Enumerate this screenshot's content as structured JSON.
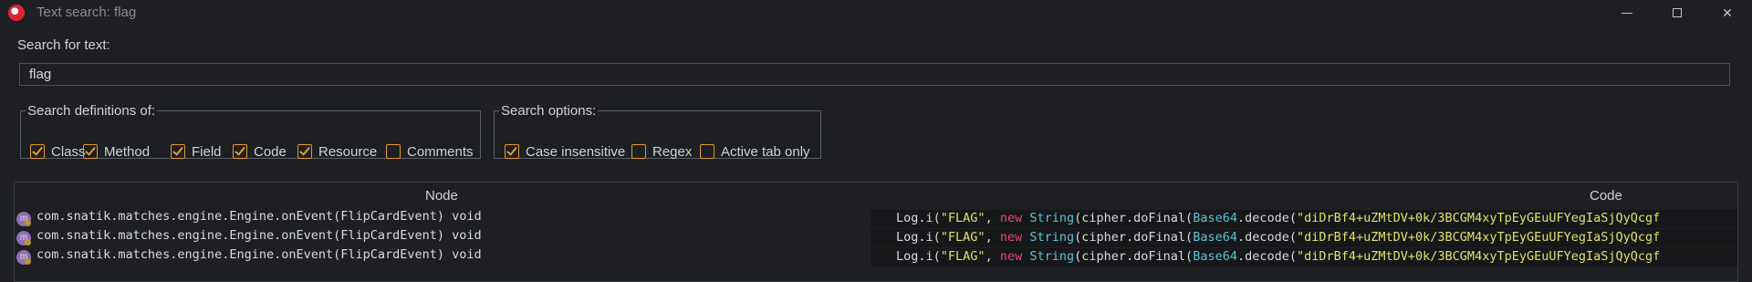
{
  "window": {
    "title": "Text search: flag",
    "icon": "jadx-app-icon",
    "controls": [
      "minimize-icon",
      "maximize-icon",
      "close-icon"
    ]
  },
  "search": {
    "label": "Search for text:",
    "value": "flag"
  },
  "definitions": {
    "legend": "Search definitions of:",
    "items": [
      {
        "label": "Class",
        "checked": true
      },
      {
        "label": "Method",
        "checked": true
      },
      {
        "label": "Field",
        "checked": true
      },
      {
        "label": "Code",
        "checked": true
      },
      {
        "label": "Resource",
        "checked": true
      },
      {
        "label": "Comments",
        "checked": false
      }
    ]
  },
  "options": {
    "legend": "Search options:",
    "items": [
      {
        "label": "Case insensitive",
        "checked": true
      },
      {
        "label": "Regex",
        "checked": false
      },
      {
        "label": "Active tab only",
        "checked": false
      }
    ]
  },
  "results": {
    "columns": {
      "node": "Node",
      "code": "Code"
    },
    "rows": [
      {
        "icon_letter": "m",
        "node": "com.snatik.matches.engine.Engine.onEvent(FlipCardEvent) void",
        "code": {
          "pre": "Log.i(",
          "s1": "\"FLAG\"",
          "c1": ", ",
          "kw": "new",
          "sp": " ",
          "cls1": "String",
          "mid": "(cipher.doFinal(",
          "cls2": "Base64",
          "dec": ".decode(",
          "s2": "\"diDrBf4+uZMtDV+0k/3BCGM4xyTpEyGEuUFYegIaSjQyQcgf"
        }
      },
      {
        "icon_letter": "m",
        "node": "com.snatik.matches.engine.Engine.onEvent(FlipCardEvent) void",
        "code": {
          "pre": "Log.i(",
          "s1": "\"FLAG\"",
          "c1": ", ",
          "kw": "new",
          "sp": " ",
          "cls1": "String",
          "mid": "(cipher.doFinal(",
          "cls2": "Base64",
          "dec": ".decode(",
          "s2": "\"diDrBf4+uZMtDV+0k/3BCGM4xyTpEyGEuUFYegIaSjQyQcgf"
        }
      },
      {
        "icon_letter": "m",
        "node": "com.snatik.matches.engine.Engine.onEvent(FlipCardEvent) void",
        "code": {
          "pre": "Log.i(",
          "s1": "\"FLAG\"",
          "c1": ", ",
          "kw": "new",
          "sp": " ",
          "cls1": "String",
          "mid": "(cipher.doFinal(",
          "cls2": "Base64",
          "dec": ".decode(",
          "s2": "\"diDrBf4+uZMtDV+0k/3BCGM4xyTpEyGEuUFYegIaSjQyQcgf"
        }
      }
    ]
  }
}
